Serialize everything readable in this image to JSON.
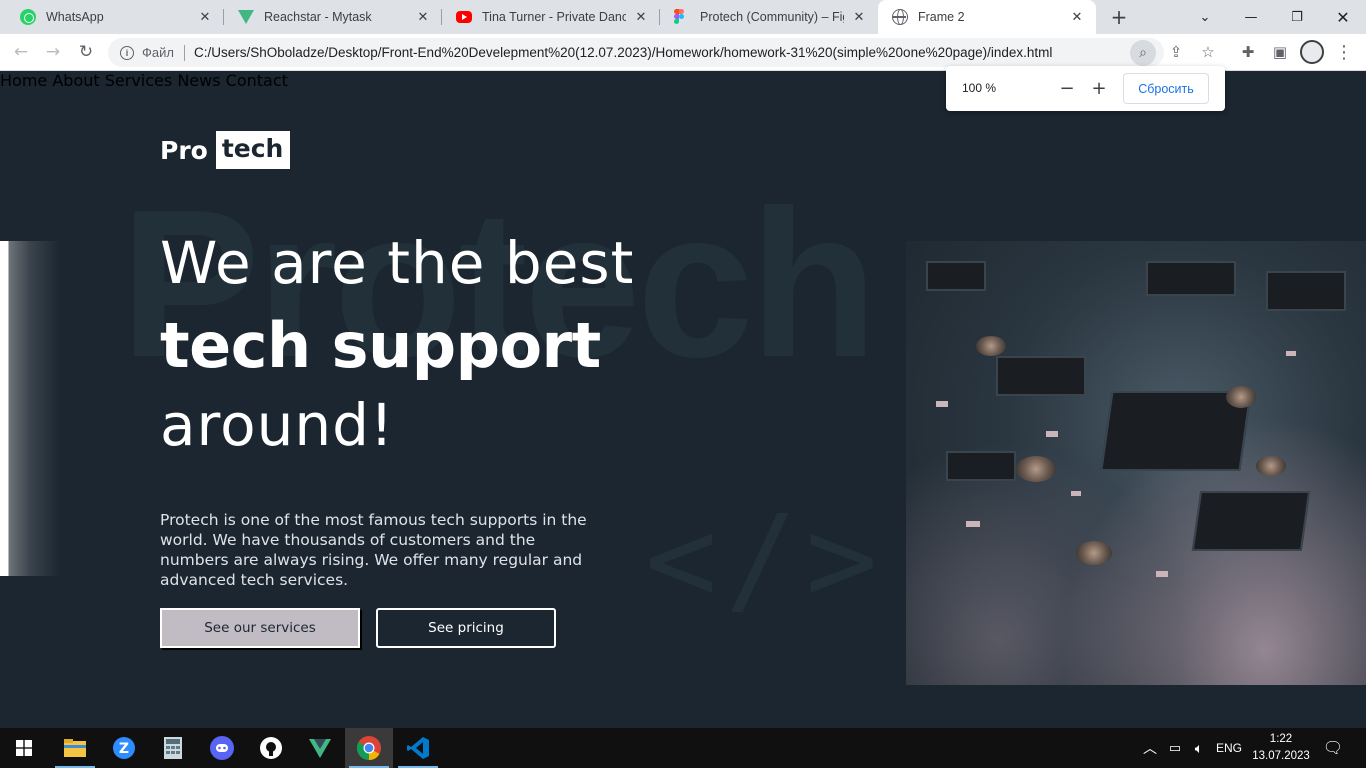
{
  "browser": {
    "tabs": [
      {
        "title": "WhatsApp",
        "icon": "whatsapp-icon"
      },
      {
        "title": "Reachstar - Mytask",
        "icon": "vue-icon"
      },
      {
        "title": "Tina Turner - Private Dancer (",
        "icon": "youtube-icon"
      },
      {
        "title": "Protech (Community) – Figm",
        "icon": "figma-icon"
      },
      {
        "title": "Frame 2",
        "icon": "globe-icon",
        "active": true
      }
    ],
    "new_tab": "+",
    "scheme_label": "Файл",
    "url": "C:/Users/ShOboladze/Desktop/Front-End%20Develepment%20(12.07.2023)/Homework/homework-31%20(simple%20one%20page)/index.html",
    "zoom_popup": {
      "value": "100 %",
      "minus": "−",
      "plus": "+",
      "reset": "Сбросить"
    }
  },
  "site": {
    "logo": {
      "part1": "Pro",
      "part2": "tech"
    },
    "nav": [
      "Home",
      "About",
      "Services",
      "News",
      "Contact"
    ],
    "background_word": "Protech",
    "background_code": "</>",
    "hero": {
      "line1": "We are the best",
      "line2": "tech support",
      "line3": "around!",
      "description": "Protech is one of the most famous tech supports in the world. We have thousands of customers and the numbers are always rising. We offer many regular and advanced tech services.",
      "primary_button": "See our services",
      "secondary_button": "See pricing"
    },
    "colors": {
      "background": "#1b2631",
      "text": "#ffffff",
      "primary_button": "#c1bcc3"
    }
  },
  "taskbar": {
    "apps": [
      "start-icon",
      "file-explorer-icon",
      "zoom-icon",
      "calculator-icon",
      "discord-icon",
      "github-icon",
      "vue-icon",
      "chrome-icon",
      "vscode-icon"
    ],
    "language": "ENG",
    "time": "1:22",
    "date": "13.07.2023"
  }
}
